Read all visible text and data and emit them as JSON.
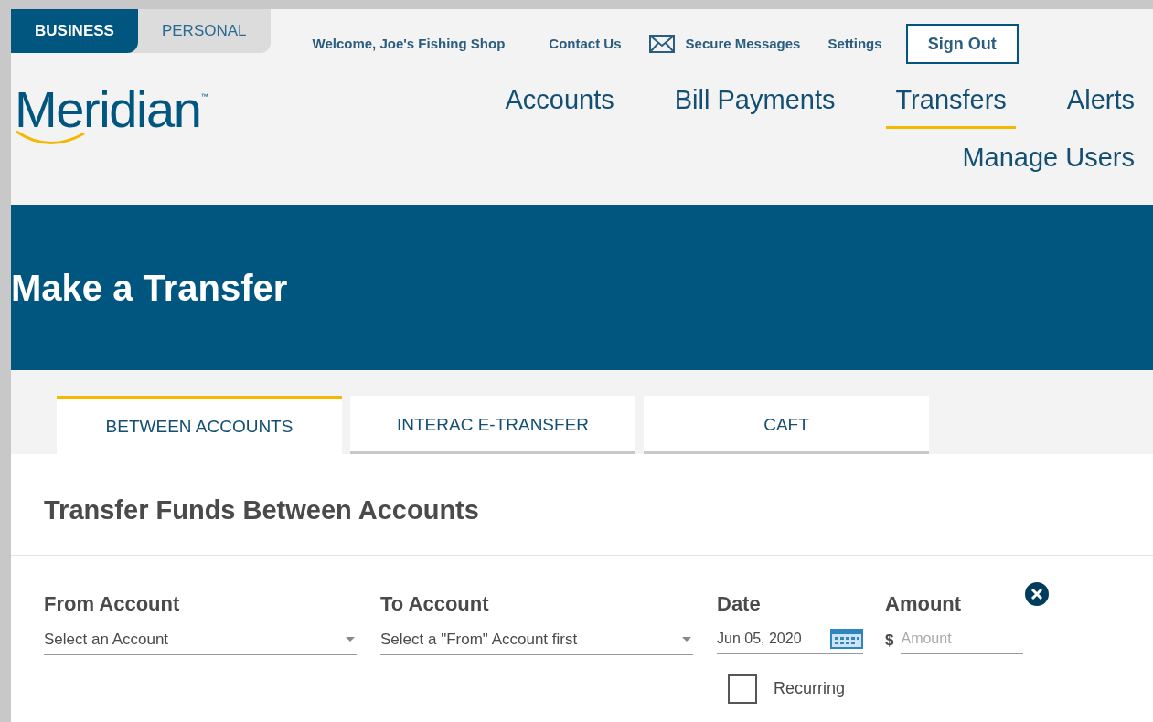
{
  "segments": [
    {
      "label": "BUSINESS",
      "selected": true
    },
    {
      "label": "PERSONAL",
      "selected": false
    }
  ],
  "welcome": "Welcome, Joe's Fishing Shop",
  "utility_links": [
    {
      "kind": "link",
      "label": "Contact Us"
    },
    {
      "kind": "mail",
      "label": "Secure Messages"
    },
    {
      "kind": "link",
      "label": "Settings"
    },
    {
      "kind": "button",
      "label": "Sign Out"
    }
  ],
  "logo": {
    "text": "Meridian",
    "mark": "™"
  },
  "main_nav": [
    {
      "label": "Accounts",
      "selected": false
    },
    {
      "label": "Bill Payments",
      "selected": false
    },
    {
      "label": "Transfers",
      "selected": true
    },
    {
      "label": "Alerts",
      "selected": false
    },
    {
      "label": "Manage Users",
      "selected": false
    }
  ],
  "banner_title": "Make a Transfer",
  "tabs": [
    {
      "label": "BETWEEN ACCOUNTS",
      "selected": true
    },
    {
      "label": "INTERAC E-TRANSFER",
      "selected": false
    },
    {
      "label": "CAFT",
      "selected": false
    }
  ],
  "section_title": "Transfer Funds Between Accounts",
  "form": {
    "from": {
      "label": "From Account",
      "value": "Select an Account"
    },
    "to": {
      "label": "To Account",
      "value": "Select a \"From\" Account first"
    },
    "date": {
      "label": "Date",
      "value": "Jun 05, 2020"
    },
    "amount": {
      "label": "Amount",
      "currency": "$",
      "placeholder": "Amount"
    },
    "recurring": {
      "label": "Recurring",
      "checked": false
    }
  }
}
